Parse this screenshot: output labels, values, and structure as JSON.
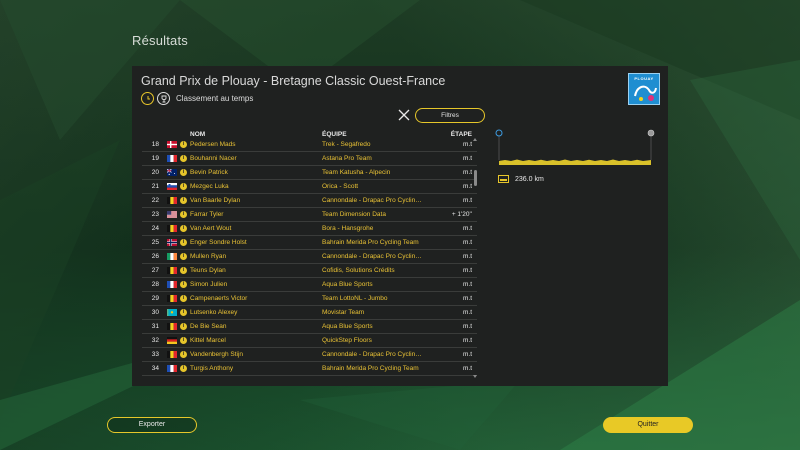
{
  "page": {
    "title": "Résultats"
  },
  "race": {
    "title": "Grand Prix de Plouay - Bretagne Classic Ouest-France",
    "classification": "Classement au temps",
    "logo_text": "PLOUAY"
  },
  "toolbar": {
    "filter_label": "Filtres"
  },
  "table": {
    "headers": {
      "name": "NOM",
      "team": "ÉQUIPE",
      "stage": "ÉTAPE"
    },
    "rows": [
      {
        "rank": "18",
        "country": "dk",
        "name": "Pedersen Mads",
        "team": "Trek - Segafredo",
        "gap": "m.t"
      },
      {
        "rank": "19",
        "country": "fr",
        "name": "Bouhanni Nacer",
        "team": "Astana Pro Team",
        "gap": "m.t"
      },
      {
        "rank": "20",
        "country": "au",
        "name": "Bevin Patrick",
        "team": "Team Katusha - Alpecin",
        "gap": "m.t"
      },
      {
        "rank": "21",
        "country": "si",
        "name": "Mezgec Luka",
        "team": "Orica - Scott",
        "gap": "m.t"
      },
      {
        "rank": "22",
        "country": "be",
        "name": "Van Baarle Dylan",
        "team": "Cannondale - Drapac Pro Cyclin…",
        "gap": "m.t"
      },
      {
        "rank": "23",
        "country": "us",
        "name": "Farrar Tyler",
        "team": "Team Dimension Data",
        "gap": "+ 1'20''"
      },
      {
        "rank": "24",
        "country": "be",
        "name": "Van Aert Wout",
        "team": "Bora - Hansgrohe",
        "gap": "m.t"
      },
      {
        "rank": "25",
        "country": "no",
        "name": "Enger Sondre Holst",
        "team": "Bahrain Merida Pro Cycling Team",
        "gap": "m.t"
      },
      {
        "rank": "26",
        "country": "ie",
        "name": "Mullen Ryan",
        "team": "Cannondale - Drapac Pro Cyclin…",
        "gap": "m.t"
      },
      {
        "rank": "27",
        "country": "be",
        "name": "Teuns Dylan",
        "team": "Cofidis, Solutions Crédits",
        "gap": "m.t"
      },
      {
        "rank": "28",
        "country": "fr",
        "name": "Simon Julien",
        "team": "Aqua Blue Sports",
        "gap": "m.t"
      },
      {
        "rank": "29",
        "country": "be",
        "name": "Campenaerts Victor",
        "team": "Team LottoNL - Jumbo",
        "gap": "m.t"
      },
      {
        "rank": "30",
        "country": "kz",
        "name": "Lutsenko Alexey",
        "team": "Movistar Team",
        "gap": "m.t"
      },
      {
        "rank": "31",
        "country": "be",
        "name": "De Bie Sean",
        "team": "Aqua Blue Sports",
        "gap": "m.t"
      },
      {
        "rank": "32",
        "country": "de",
        "name": "Kittel Marcel",
        "team": "QuickStep Floors",
        "gap": "m.t"
      },
      {
        "rank": "33",
        "country": "be",
        "name": "Vandenbergh Stijn",
        "team": "Cannondale - Drapac Pro Cyclin…",
        "gap": "m.t"
      },
      {
        "rank": "34",
        "country": "fr",
        "name": "Turgis Anthony",
        "team": "Bahrain Merida Pro Cycling Team",
        "gap": "m.t"
      }
    ]
  },
  "stage": {
    "distance": "236.0 km"
  },
  "footer": {
    "export_label": "Exporter",
    "quit_label": "Quitter"
  },
  "colors": {
    "accent": "#e6c52a",
    "panel": "#1f2120",
    "name_text": "#e9c235"
  }
}
